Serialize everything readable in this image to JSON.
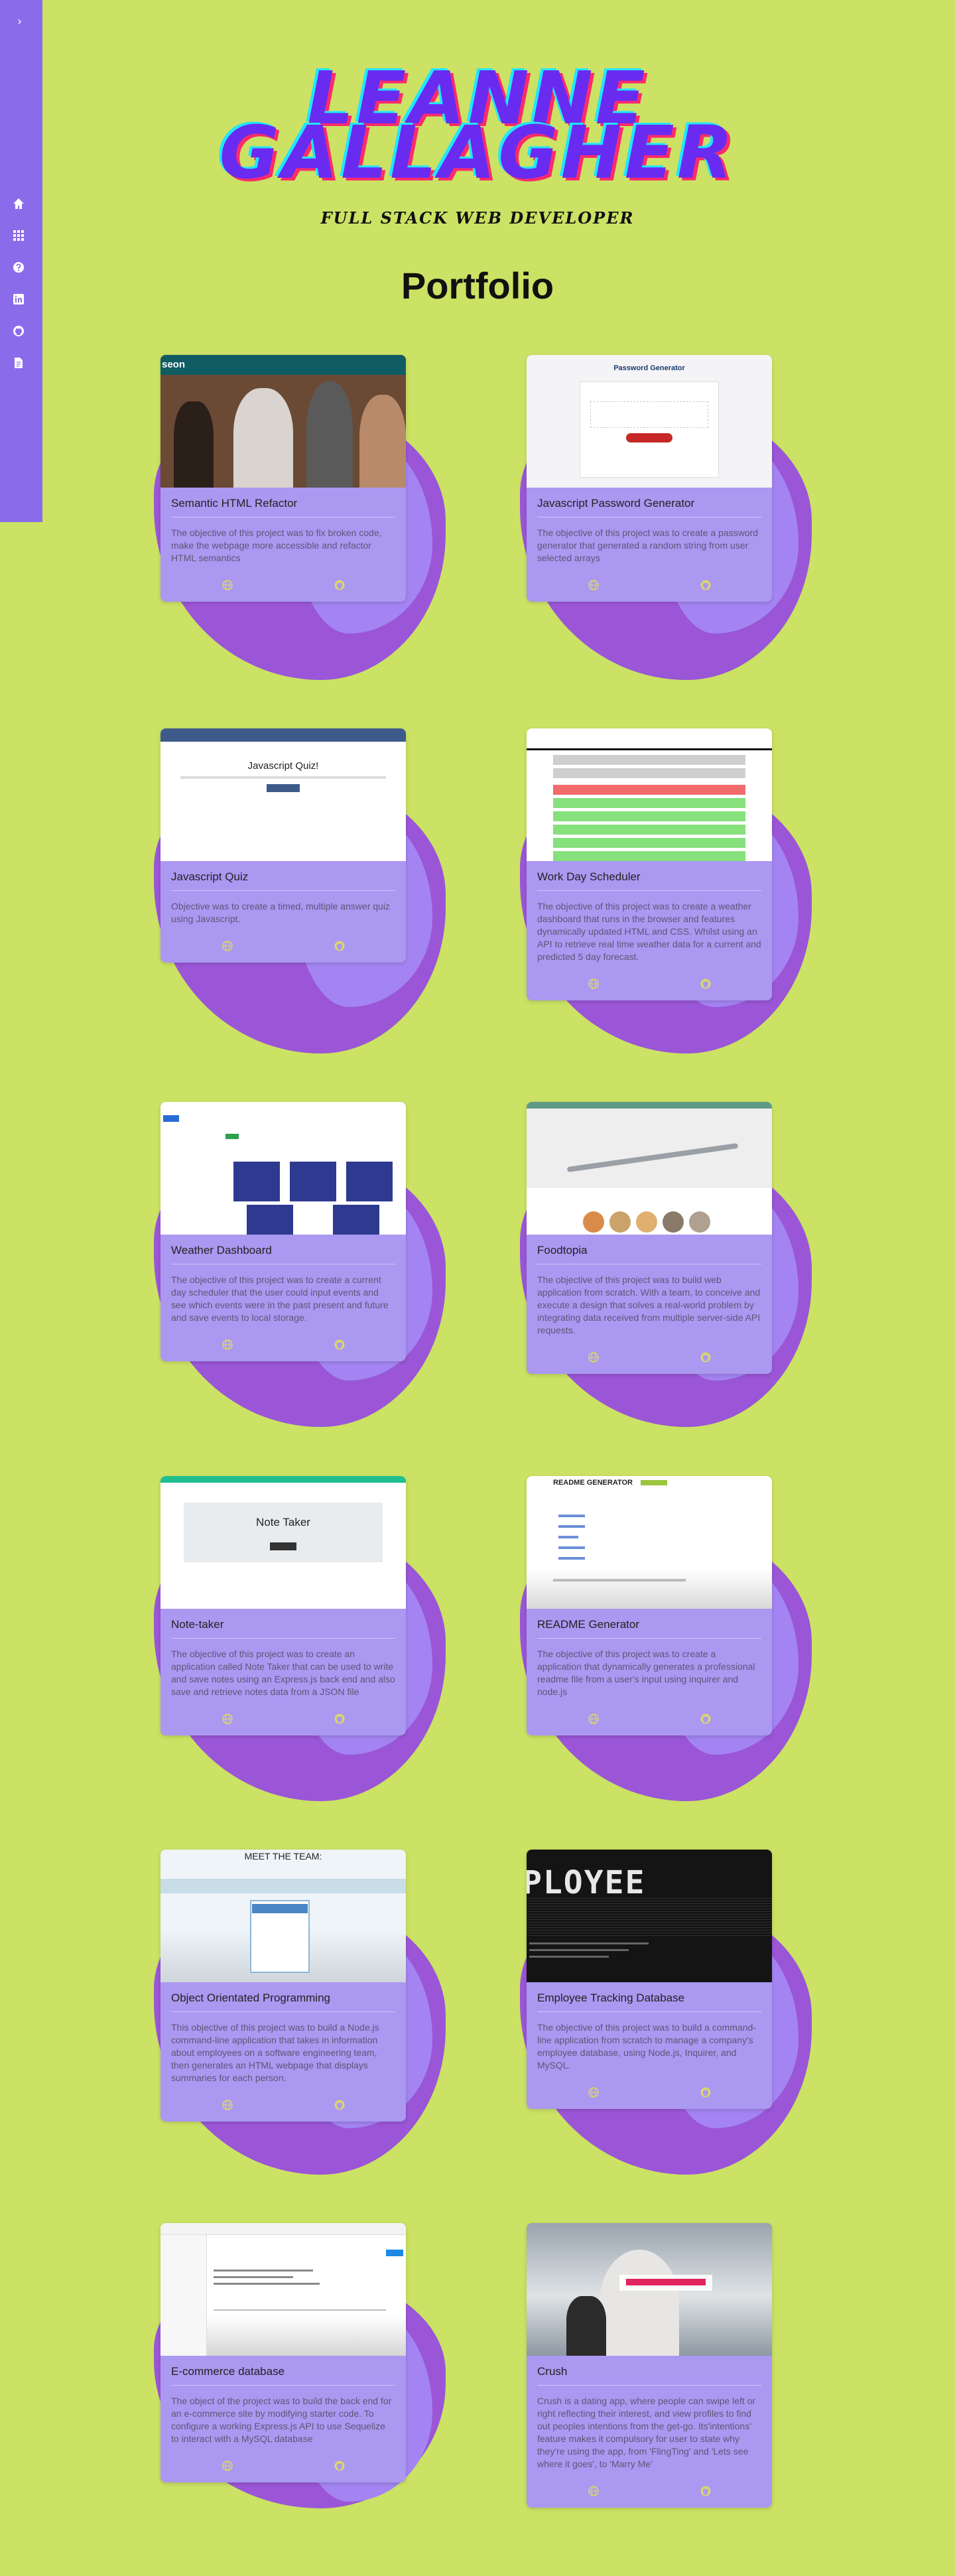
{
  "sidebar": {
    "toggle_icon": "chevron-right-icon",
    "icons": [
      "home-icon",
      "grid-icon",
      "question-icon",
      "linkedin-icon",
      "github-icon",
      "document-icon"
    ]
  },
  "header": {
    "name_line1": "LEANNE",
    "name_line2": "GALLAGHER",
    "role": "FULL STACK WEB DEVELOPER"
  },
  "portfolio": {
    "title": "Portfolio",
    "projects": [
      {
        "title": "Semantic HTML Refactor",
        "description": "The objective of this project was to fix broken code, make the webpage more accessible and refactor HTML semantics",
        "shot_label": "seon"
      },
      {
        "title": "Javascript Password Generator",
        "description": "The objective of this project was to create a password generator that generated a random string from user selected arrays",
        "shot_label": "Password Generator"
      },
      {
        "title": "Javascript Quiz",
        "description": "Objective was to create a timed, multiple answer quiz using Javascript.",
        "shot_label": "Javascript Quiz!"
      },
      {
        "title": "Work Day Scheduler",
        "description": "The objective of this project was to create a weather dashboard that runs in the browser and features dynamically updated HTML and CSS. Whilst using an API to retrieve real time weather data for a current and predicted 5 day forecast.",
        "shot_label": ""
      },
      {
        "title": "Weather Dashboard",
        "description": "The objective of this project was to create a current day scheduler that the user could input events and see which events were in the past present and future and save events to local storage.",
        "shot_label": ""
      },
      {
        "title": "Foodtopia",
        "description": "The objective of this project was to build web application from scratch. With a team, to conceive and execute a design that solves a real-world problem by integrating data received from multiple server-side API requests.",
        "shot_label": ""
      },
      {
        "title": "Note-taker",
        "description": "The objective of this project was to create an application called Note Taker that can be used to write and save notes using an Express.js back end and also save and retrieve notes data from a JSON file",
        "shot_label": "Note Taker"
      },
      {
        "title": "README Generator",
        "description": "The objective of this project was to create a application that dynamically generates a professional readme file from a user's input using inquirer and node.js",
        "shot_label": "README GENERATOR"
      },
      {
        "title": "Object Orientated Programming",
        "description": "This objective of this project was to build a Node.js command-line application that takes in information about employees on a software engineering team, then generates an HTML webpage that displays summaries for each person.",
        "shot_label": "MEET THE TEAM:"
      },
      {
        "title": "Employee Tracking Database",
        "description": "The objective of this project was to build a command-line application from scratch to manage a company's employee database, using Node.js, Inquirer, and MySQL.",
        "shot_label": "PLOYEE"
      },
      {
        "title": "E-commerce database",
        "description": "The object of the project was to build the back end for an e-commerce site by modifying starter code. To configure a working Express.js API to use Sequelize to interact with a MySQL database",
        "shot_label": ""
      },
      {
        "title": "Crush",
        "description": "Crush is a dating app, where people can swipe left or right reflecting their interest, and view profiles to find out peoples intentions from the get-go. Its'intentions' feature makes it compulsory for user to state why they're using the app, from 'FlingTing' and 'Lets see where it goes', to 'Marry Me'",
        "shot_label": ""
      }
    ]
  },
  "colors": {
    "background": "#cbe264",
    "sidebar": "#8a6cea",
    "card": "#ab98f1",
    "blob": "#9a56d6",
    "name": "#6a2bf0"
  },
  "card_link_icons": [
    "globe-icon",
    "github-icon"
  ]
}
